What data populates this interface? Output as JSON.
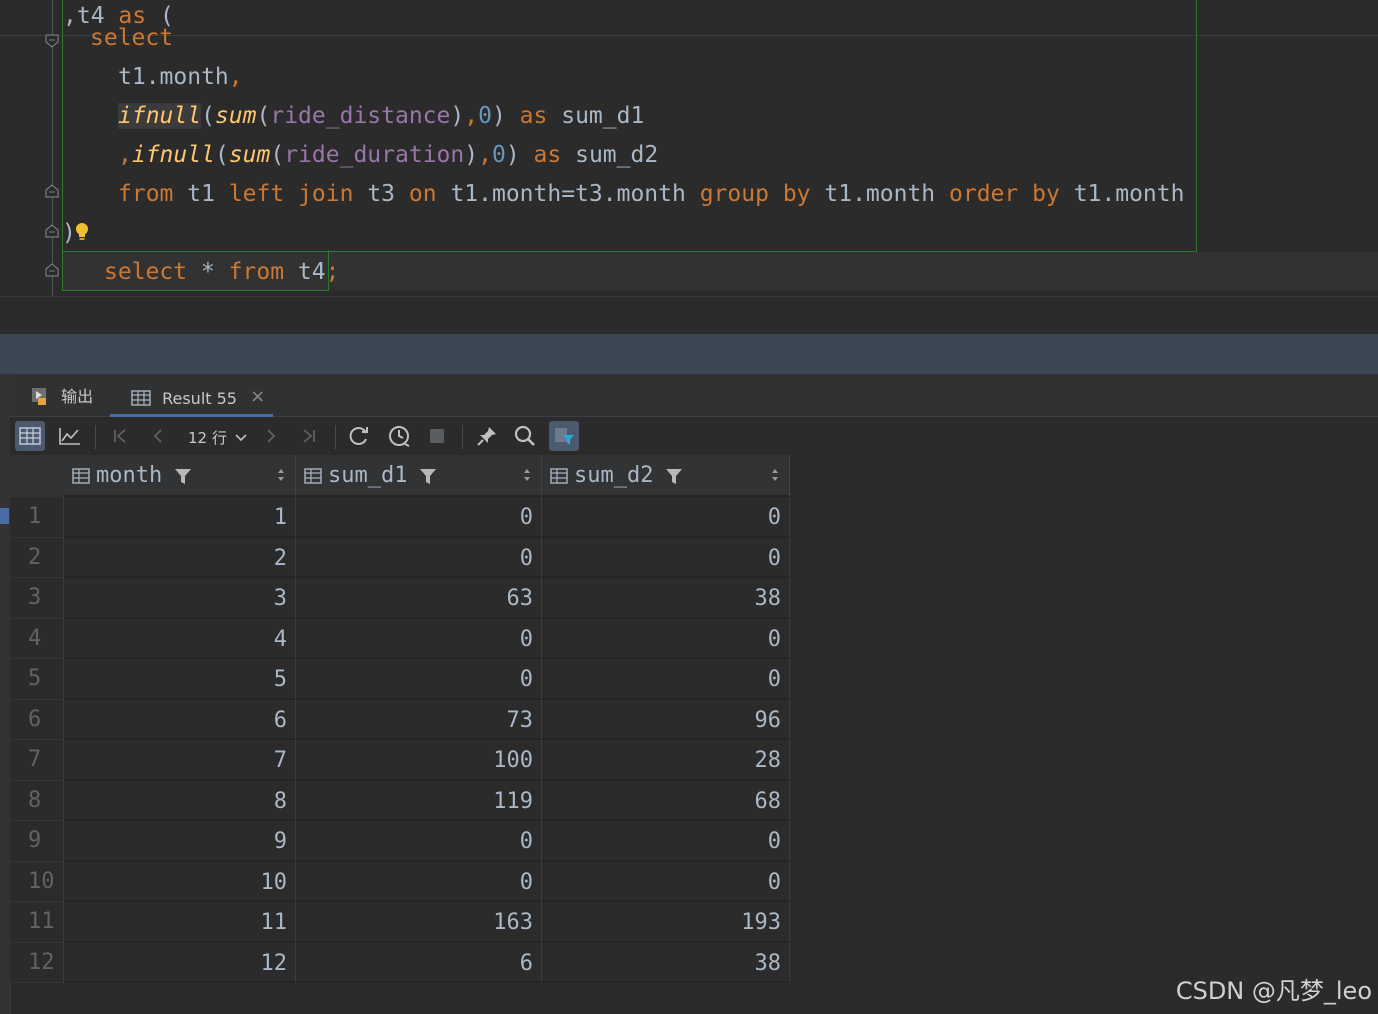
{
  "editor": {
    "lines": {
      "l0": {
        "punct": ",",
        "name": "t4",
        "kw": "as",
        "paren": "("
      },
      "l1": {
        "kw": "select"
      },
      "l2": {
        "text": "t1.month",
        "comma": ","
      },
      "l3": {
        "fn1": "ifnull",
        "p1": "(",
        "fn2": "sum",
        "p2": "(",
        "col": "ride_distance",
        "p3": ")",
        "comma": ",",
        "num": "0",
        "p4": ")",
        "kw": "as",
        "alias": "sum_d1"
      },
      "l4": {
        "comma": ",",
        "fn1": "ifnull",
        "p1": "(",
        "fn2": "sum",
        "p2": "(",
        "col": "ride_duration",
        "p3": ")",
        "comma2": ",",
        "num": "0",
        "p4": ")",
        "kw": "as",
        "alias": "sum_d2"
      },
      "l5": {
        "from": "from",
        "t1": "t1",
        "left": "left",
        "join": "join",
        "t3": "t3",
        "on": "on",
        "cond": "t1.month=t3.month",
        "group": "group",
        "by1": "by",
        "g": "t1.month",
        "order": "order",
        "by2": "by",
        "o": "t1.month"
      },
      "l6": {
        "paren": ")"
      },
      "l7": {
        "select": "select",
        "star": "*",
        "from": "from",
        "table": "t4",
        "semi": ";"
      }
    }
  },
  "tabs": {
    "output": "输出",
    "result": "Result 55",
    "close": "×"
  },
  "toolbar": {
    "rows_label": "12 行"
  },
  "table": {
    "columns": [
      "month",
      "sum_d1",
      "sum_d2"
    ],
    "rows": [
      [
        "1",
        "0",
        "0"
      ],
      [
        "2",
        "0",
        "0"
      ],
      [
        "3",
        "63",
        "38"
      ],
      [
        "4",
        "0",
        "0"
      ],
      [
        "5",
        "0",
        "0"
      ],
      [
        "6",
        "73",
        "96"
      ],
      [
        "7",
        "100",
        "28"
      ],
      [
        "8",
        "119",
        "68"
      ],
      [
        "9",
        "0",
        "0"
      ],
      [
        "10",
        "0",
        "0"
      ],
      [
        "11",
        "163",
        "193"
      ],
      [
        "12",
        "6",
        "38"
      ]
    ]
  },
  "watermark": "CSDN @凡梦_leo",
  "colors": {
    "keyword": "#cc7832",
    "function": "#ffc66d",
    "column": "#9876aa",
    "number": "#6897bb",
    "accent": "#4a6da7",
    "selection_border": "#2f7a2f"
  }
}
